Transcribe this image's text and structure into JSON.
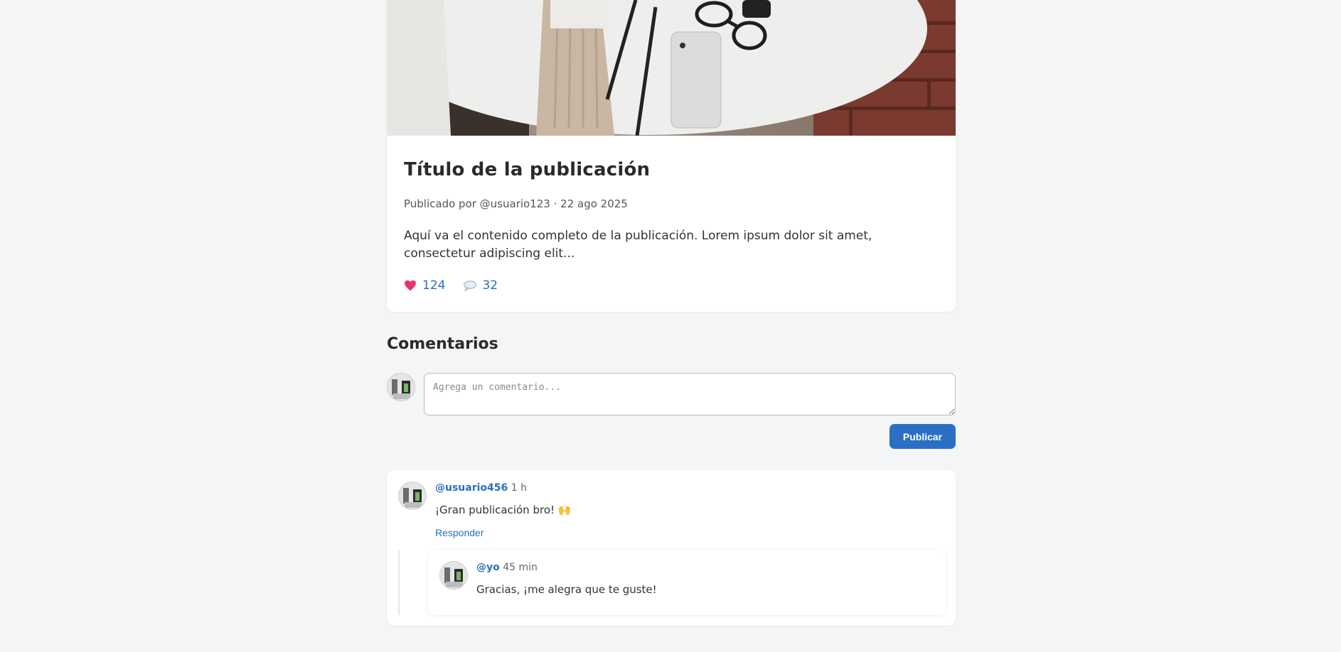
{
  "post": {
    "image_alt": "post-photo",
    "title": "Título de la publicación",
    "meta": "Publicado por @usuario123 · 22 ago 2025",
    "body": "Aquí va el contenido completo de la publicación. Lorem ipsum dolor sit amet, consectetur adipiscing elit...",
    "likes": "124",
    "comments": "32"
  },
  "comments_section": {
    "heading": "Comentarios",
    "input_placeholder": "Agrega un comentario...",
    "publish_label": "Publicar",
    "items": [
      {
        "user": "@usuario456",
        "time": "1 h",
        "text": "¡Gran publicación bro! 🙌",
        "reply_label": "Responder",
        "replies": [
          {
            "user": "@yo",
            "time": "45 min",
            "text": "Gracias, ¡me alegra que te guste!"
          }
        ]
      }
    ]
  },
  "colors": {
    "accent": "#2a6fc4",
    "background": "#f4f5f7",
    "heart": "#e8336b"
  },
  "icons": {
    "like": "heart-icon",
    "comment": "speech-bubble-icon"
  }
}
